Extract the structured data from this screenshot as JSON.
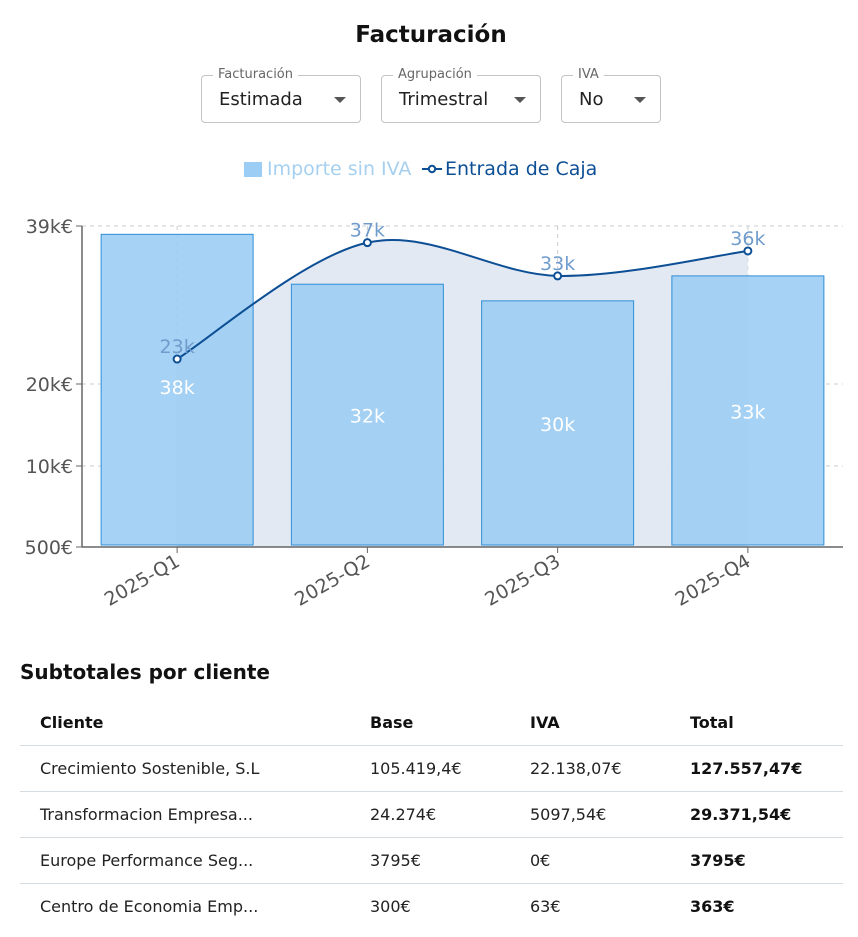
{
  "page": {
    "title": "Facturación"
  },
  "filters": [
    {
      "label": "Facturación",
      "value": "Estimada"
    },
    {
      "label": "Agrupación",
      "value": "Trimestral"
    },
    {
      "label": "IVA",
      "value": "No"
    }
  ],
  "legend": {
    "bar": "Importe sin IVA",
    "line": "Entrada de Caja"
  },
  "chart_data": {
    "type": "bar",
    "categories": [
      "2025-Q1",
      "2025-Q2",
      "2025-Q3",
      "2025-Q4"
    ],
    "series": [
      {
        "name": "Importe sin IVA",
        "type": "bar",
        "values": [
          38000,
          32000,
          30000,
          33000
        ],
        "labels": [
          "38k",
          "32k",
          "30k",
          "33k"
        ]
      },
      {
        "name": "Entrada de Caja",
        "type": "line",
        "values": [
          23000,
          37000,
          33000,
          36000
        ],
        "labels": [
          "23k",
          "37k",
          "33k",
          "36k"
        ]
      }
    ],
    "yticks": [
      {
        "label": "39k€",
        "value": 39000
      },
      {
        "label": "20k€",
        "value": 20000
      },
      {
        "label": "10k€",
        "value": 10000
      },
      {
        "label": "500€",
        "value": 500
      }
    ],
    "ylim": [
      500,
      39000
    ],
    "grid": true,
    "legend_position": "top-center",
    "colors": {
      "bar": "#9ccdf4",
      "bar_border": "#2f8fd6",
      "line": "#0d4f95",
      "area": "#e2e8f2"
    }
  },
  "subtotals": {
    "title": "Subtotales por cliente",
    "columns": [
      "Cliente",
      "Base",
      "IVA",
      "Total"
    ],
    "rows": [
      [
        "Crecimiento Sostenible, S.L",
        "105.419,4€",
        "22.138,07€",
        "127.557,47€"
      ],
      [
        "Transformacion Empresa...",
        "24.274€",
        "5097,54€",
        "29.371,54€"
      ],
      [
        "Europe Performance Seg...",
        "3795€",
        "0€",
        "3795€"
      ],
      [
        "Centro de Economia Emp...",
        "300€",
        "63€",
        "363€"
      ]
    ]
  }
}
